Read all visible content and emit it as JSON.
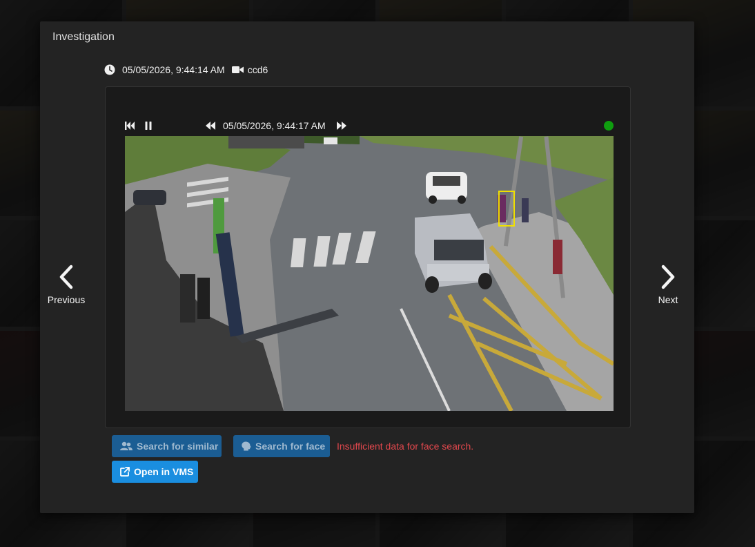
{
  "dialog": {
    "title": "Investigation"
  },
  "meta": {
    "timestamp": "05/05/2026, 9:44:14 AM",
    "camera": "ccd6",
    "clock_icon": "clock-icon",
    "camera_icon": "video-camera-icon"
  },
  "player": {
    "current_time": "05/05/2026, 9:44:17 AM",
    "live_status_color": "#0f9d0f",
    "controls": [
      "skip-to-start-icon",
      "pause-icon",
      "rewind-icon",
      "fast-forward-icon"
    ],
    "detection_box_color": "#f0e000"
  },
  "nav": {
    "previous_label": "Previous",
    "next_label": "Next"
  },
  "actions": {
    "search_similar_label": "Search for similar",
    "search_face_label": "Search for face",
    "face_error": "Insufficient data for face search.",
    "open_vms_label": "Open in VMS"
  },
  "colors": {
    "accent": "#1a8ee0",
    "disabled_button": "#1b5d93",
    "error": "#e0474c",
    "dialog_bg": "#232323"
  }
}
